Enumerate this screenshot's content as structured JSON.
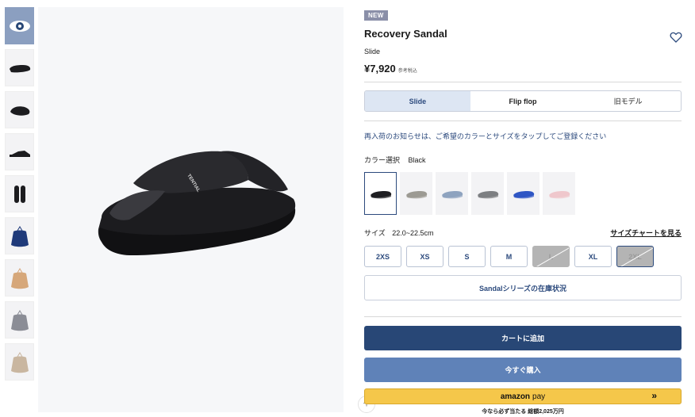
{
  "product": {
    "badge": "NEW",
    "title": "Recovery Sandal",
    "subtitle": "Slide",
    "price": "¥7,920",
    "tax_note": "参考税込"
  },
  "thumbnails": [
    {
      "name": "thumb-logo",
      "icon": "logo-icon",
      "active": true
    },
    {
      "name": "thumb-side",
      "icon": "sandal-side-icon"
    },
    {
      "name": "thumb-angle",
      "icon": "sandal-angle-icon"
    },
    {
      "name": "thumb-profile",
      "icon": "sandal-profile-icon"
    },
    {
      "name": "thumb-top",
      "icon": "sandal-pair-icon"
    },
    {
      "name": "thumb-bag-navy",
      "icon": "bag-icon"
    },
    {
      "name": "thumb-bag-brown",
      "icon": "bag-icon"
    },
    {
      "name": "thumb-bag-gray",
      "icon": "bag-icon"
    },
    {
      "name": "thumb-bag-beige",
      "icon": "bag-icon"
    }
  ],
  "main_image": {
    "brand_print": "TENTIAL",
    "zoom_label": "+"
  },
  "tabs": [
    {
      "label": "Slide",
      "active": true
    },
    {
      "label": "Flip flop",
      "active": false
    },
    {
      "label": "旧モデル",
      "active": false
    }
  ],
  "restock_notice": "再入荷のお知らせは、ご希望のカラーとサイズをタップしてご登録ください",
  "color": {
    "label": "カラー選択",
    "selected": "Black",
    "swatches": [
      {
        "color": "#1f1f22",
        "selected": true
      },
      {
        "color": "#9c9a93"
      },
      {
        "color": "#8ea3bf"
      },
      {
        "color": "#7d7f82"
      },
      {
        "color": "#2f56c4"
      },
      {
        "color": "#efc7cc"
      }
    ]
  },
  "size": {
    "label": "サイズ",
    "range": "22.0~22.5cm",
    "chart_link": "サイズチャートを見る",
    "options": [
      {
        "label": "2XS",
        "soldout": false
      },
      {
        "label": "XS",
        "soldout": false
      },
      {
        "label": "S",
        "soldout": false
      },
      {
        "label": "M",
        "soldout": false
      },
      {
        "label": "L",
        "soldout": true
      },
      {
        "label": "XL",
        "soldout": false
      },
      {
        "label": "2XL",
        "soldout": true,
        "selected": true
      }
    ]
  },
  "stock_button": "Sandalシリーズの在庫状況",
  "cart_button": "カートに追加",
  "buy_button": "今すぐ購入",
  "amazon": {
    "logo": "amazon",
    "pay": "pay",
    "arrow": "»",
    "points_note": "今なら必ず当たる 総額2,025万円"
  },
  "colors": {
    "primary": "#284776",
    "secondary": "#5f82b8",
    "amazon": "#f5c74a",
    "badge": "#8a8fa8"
  }
}
